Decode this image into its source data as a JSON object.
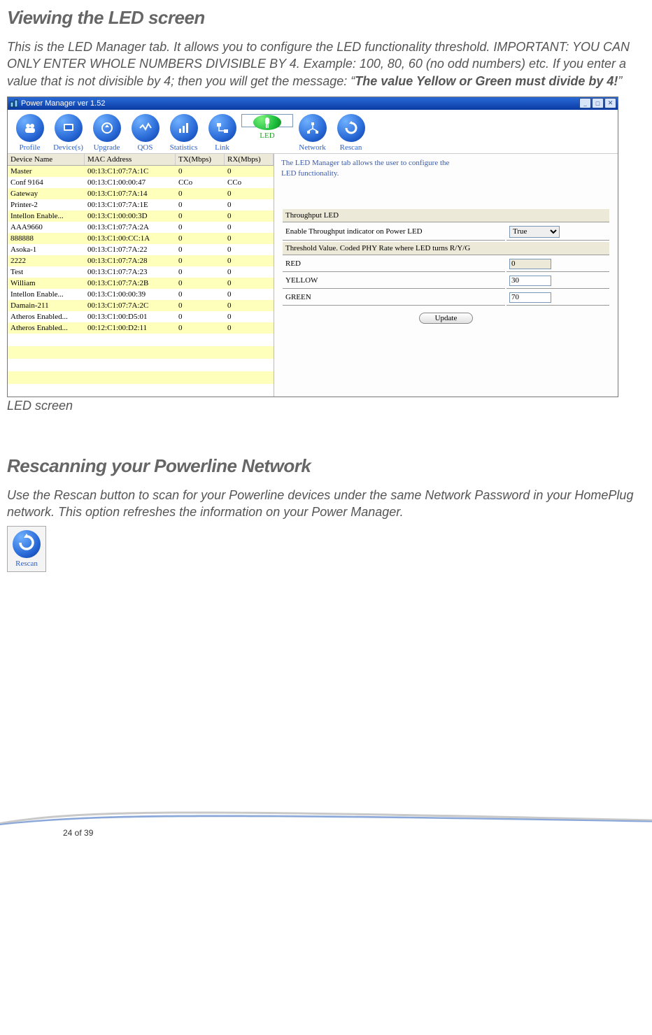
{
  "headings": {
    "h1": "Viewing the LED screen",
    "h2": "Rescanning your Powerline Network"
  },
  "paragraphs": {
    "p1_a": "This is the LED Manager tab. It allows you to configure the LED functionality threshold. IMPORTANT: YOU CAN ONLY ENTER WHOLE NUMBERS DIVISIBLE BY 4. Example: 100, 80, 60 (no odd numbers) etc. If you enter a value that is not divisible by 4; then you will get the message: “",
    "p1_b": "The value Yellow or Green must divide by 4!",
    "p1_c": "”",
    "caption1": "LED screen",
    "p2_a": "Use the ",
    "p2_b": "Rescan",
    "p2_c": " button to scan for your Powerline devices under the same Network Password in your HomePlug network.  This option refreshes the information on your Power Manager."
  },
  "app": {
    "title": "Power Manager ver 1.52",
    "info": "The LED Manager tab allows the user to configure the LED functionality.",
    "tabs": [
      {
        "label": "Profile"
      },
      {
        "label": "Device(s)"
      },
      {
        "label": "Upgrade"
      },
      {
        "label": "QOS"
      },
      {
        "label": "Statistics"
      },
      {
        "label": "Link"
      },
      {
        "label": "LED",
        "selected": true
      },
      {
        "label": "Network"
      },
      {
        "label": "Rescan"
      }
    ],
    "table": {
      "headers": {
        "name": "Device Name",
        "mac": "MAC Address",
        "tx": "TX(Mbps)",
        "rx": "RX(Mbps)"
      },
      "rows": [
        {
          "name": "Master",
          "mac": "00:13:C1:07:7A:1C",
          "tx": "0",
          "rx": "0"
        },
        {
          "name": "Conf 9164",
          "mac": "00:13:C1:00:00:47",
          "tx": "CCo",
          "rx": "CCo"
        },
        {
          "name": "Gateway",
          "mac": "00:13:C1:07:7A:14",
          "tx": "0",
          "rx": "0"
        },
        {
          "name": "Printer-2",
          "mac": "00:13:C1:07:7A:1E",
          "tx": "0",
          "rx": "0"
        },
        {
          "name": "Intellon Enable...",
          "mac": "00:13:C1:00:00:3D",
          "tx": "0",
          "rx": "0"
        },
        {
          "name": "AAA9660",
          "mac": "00:13:C1:07:7A:2A",
          "tx": "0",
          "rx": "0"
        },
        {
          "name": "888888",
          "mac": "00:13:C1:00:CC:1A",
          "tx": "0",
          "rx": "0"
        },
        {
          "name": "Asoka-1",
          "mac": "00:13:C1:07:7A:22",
          "tx": "0",
          "rx": "0"
        },
        {
          "name": "2222",
          "mac": "00:13:C1:07:7A:28",
          "tx": "0",
          "rx": "0"
        },
        {
          "name": "Test",
          "mac": "00:13:C1:07:7A:23",
          "tx": "0",
          "rx": "0"
        },
        {
          "name": "William",
          "mac": "00:13:C1:07:7A:2B",
          "tx": "0",
          "rx": "0"
        },
        {
          "name": "Intellon Enable...",
          "mac": "00:13:C1:00:00:39",
          "tx": "0",
          "rx": "0"
        },
        {
          "name": "Damain-211",
          "mac": "00:13:C1:07:7A:2C",
          "tx": "0",
          "rx": "0"
        },
        {
          "name": "Atheros Enabled...",
          "mac": "00:13:C1:00:D5:01",
          "tx": "0",
          "rx": "0"
        },
        {
          "name": "Atheros Enabled...",
          "mac": "00:12:C1:00:D2:11",
          "tx": "0",
          "rx": "0"
        }
      ]
    },
    "settings": {
      "section1": "Throughput LED",
      "enable_label": "Enable Throughput indicator on Power LED",
      "enable_value": "True",
      "section2": "Threshold Value. Coded PHY Rate where LED turns R/Y/G",
      "red": {
        "label": "RED",
        "value": "0"
      },
      "yellow": {
        "label": "YELLOW",
        "value": "30"
      },
      "green": {
        "label": "GREEN",
        "value": "70"
      },
      "update": "Update"
    }
  },
  "rescan_fig": {
    "label": "Rescan"
  },
  "page_number": "24 of 39"
}
